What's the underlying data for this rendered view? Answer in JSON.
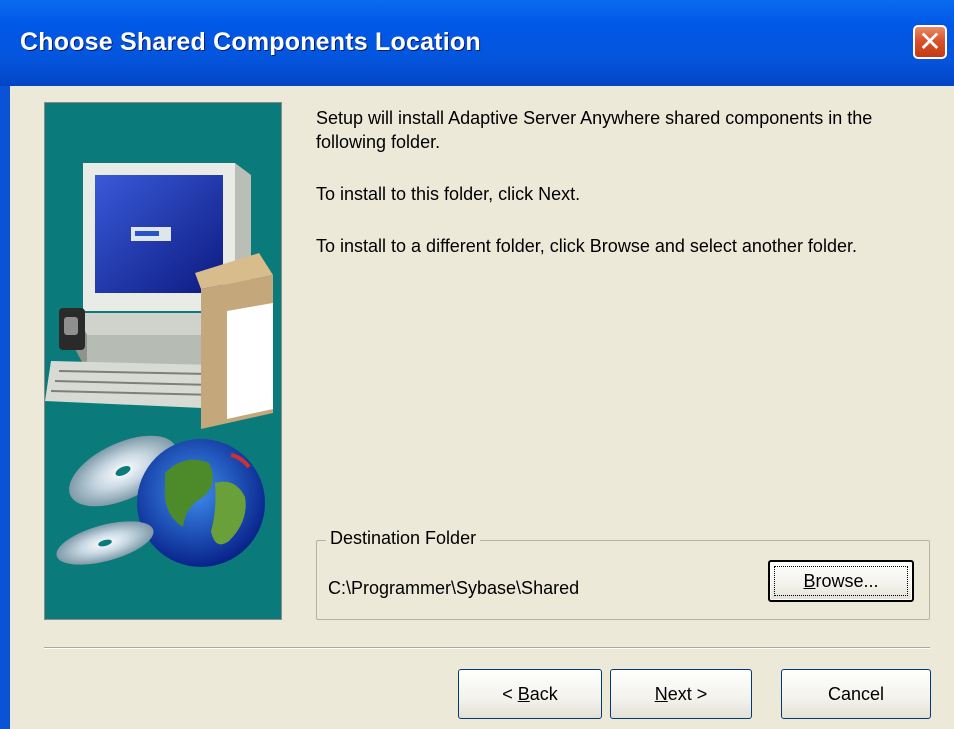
{
  "window": {
    "title": "Choose Shared Components Location",
    "close_glyph": "✕"
  },
  "body": {
    "para1": "Setup will install Adaptive Server Anywhere shared components in the following folder.",
    "para2": "To install to this folder, click Next.",
    "para3": "To install to a different folder, click Browse and select another folder."
  },
  "destination": {
    "group_label": "Destination Folder",
    "path": "C:\\Programmer\\Sybase\\Shared",
    "browse_pre": "",
    "browse_key": "B",
    "browse_post": "rowse..."
  },
  "buttons": {
    "back_pre": "< ",
    "back_key": "B",
    "back_post": "ack",
    "next_key": "N",
    "next_post": "ext >",
    "cancel": "Cancel"
  },
  "colors": {
    "title_bar": "#0058e6",
    "dialog_bg": "#ece9d8",
    "image_bg": "#0a7b7a"
  }
}
